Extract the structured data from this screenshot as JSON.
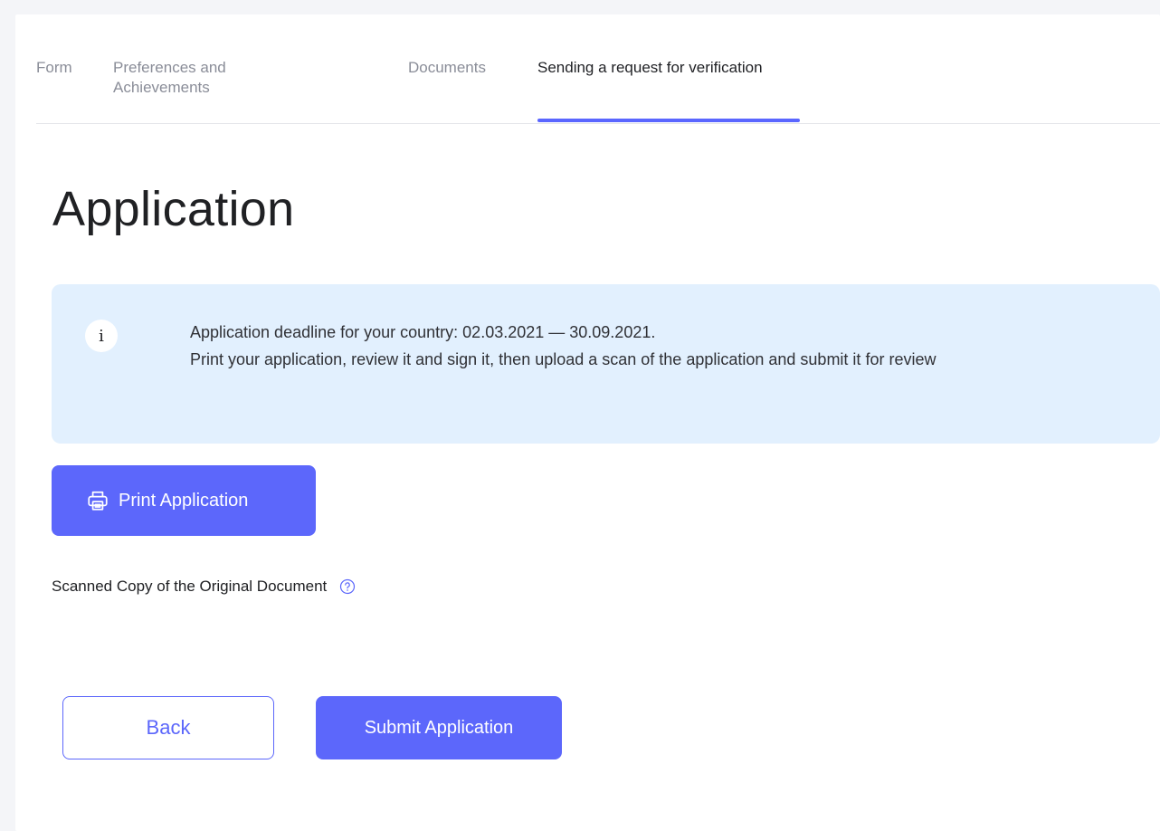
{
  "tabs": [
    {
      "label": "Form"
    },
    {
      "label": "Preferences and Achievements"
    },
    {
      "label": "Documents"
    },
    {
      "label": "Sending a request for verification"
    }
  ],
  "active_tab_index": 3,
  "page_title": "Application",
  "info": {
    "line1": "Application deadline for your country: 02.03.2021 — 30.09.2021.",
    "line2": "Print your application, review it and sign it, then upload a scan of the application and submit it for review",
    "icon": "info-icon"
  },
  "print_button": {
    "label": "Print Application",
    "icon": "printer-icon"
  },
  "scan_label": "Scanned Copy of the Original Document",
  "back_button": {
    "label": "Back"
  },
  "submit_button": {
    "label": "Submit Application"
  },
  "colors": {
    "accent": "#5c67fb",
    "info_bg": "#e2f0fe",
    "text_dark": "#202124",
    "text_muted": "#8a8d98"
  }
}
